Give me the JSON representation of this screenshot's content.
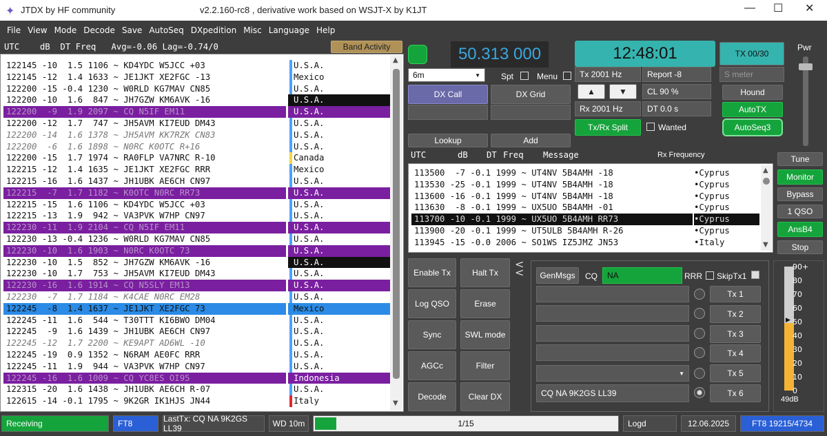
{
  "window": {
    "title": "JTDX   by HF community",
    "subtitle": "v2.2.160-rc8 , derivative work based on WSJT-X by K1JT"
  },
  "menu": [
    "File",
    "View",
    "Mode",
    "Decode",
    "Save",
    "AutoSeq",
    "DXpedition",
    "Misc",
    "Language",
    "Help"
  ],
  "band_activity": {
    "header": "UTC    dB  DT Freq   Avg=-0.06 Lag=-0.74/0",
    "button": "Band Activity",
    "rows": [
      {
        "t": "122145 -10  1.5 1106 ~ KD4YDC W5JCC +03",
        "c": "U.S.A.",
        "s": "norm",
        "m": "#4aa3ff"
      },
      {
        "t": "122145 -12  1.4 1633 ~ JE1JKT XE2FGC -13",
        "c": "Mexico",
        "s": "norm",
        "m": "#4aa3ff"
      },
      {
        "t": "122200 -15 -0.4 1230 ~ W0RLD KG7MAV CN85",
        "c": "U.S.A.",
        "s": "norm",
        "m": "#4aa3ff"
      },
      {
        "t": "122200 -10  1.6  847 ~ JH7GZW KM6AVK -16",
        "c": "U.S.A.",
        "s": "norm",
        "m": "#111"
      },
      {
        "t": "122200  -9  1.9 2097 ~ CQ N5IF EM11",
        "c": "U.S.A.",
        "s": "hl",
        "m": "#7a1fa0"
      },
      {
        "t": "122200 -12  1.7  747 ~ JH5AVM KI7EUD DM43",
        "c": "U.S.A.",
        "s": "norm",
        "m": "#4aa3ff"
      },
      {
        "t": "122200 -14  1.6 1378 ~ JH5AVM KK7RZK CN83",
        "c": "U.S.A.",
        "s": "old",
        "m": "#4aa3ff"
      },
      {
        "t": "122200  -6  1.6 1898 ~ N0RC K0OTC R+16",
        "c": "U.S.A.",
        "s": "old",
        "m": "#4aa3ff"
      },
      {
        "t": "122200 -15  1.7 1974 ~ RA0FLP VA7NRC R-10",
        "c": "Canada",
        "s": "norm",
        "m": "#f5d742"
      },
      {
        "t": "122215 -12  1.4 1635 ~ JE1JKT XE2FGC RRR",
        "c": "Mexico",
        "s": "norm",
        "m": "#4aa3ff"
      },
      {
        "t": "122215 -16  1.6 1437 ~ JH1UBK AE6CH CN97",
        "c": "U.S.A.",
        "s": "norm",
        "m": "#4aa3ff"
      },
      {
        "t": "122215  -7  1.7 1182 ~ K0OTC N0RC RR73",
        "c": "U.S.A.",
        "s": "hl",
        "m": "#7a1fa0"
      },
      {
        "t": "122215 -15  1.6 1106 ~ KD4YDC W5JCC +03",
        "c": "U.S.A.",
        "s": "norm",
        "m": "#4aa3ff"
      },
      {
        "t": "122215 -13  1.9  942 ~ VA3PVK W7HP CN97",
        "c": "U.S.A.",
        "s": "norm",
        "m": "#4aa3ff"
      },
      {
        "t": "122230 -11  1.9 2104 ~ CQ N5IF EM11",
        "c": "U.S.A.",
        "s": "hl",
        "m": "#7a1fa0"
      },
      {
        "t": "122230 -13 -0.4 1236 ~ W0RLD KG7MAV CN85",
        "c": "U.S.A.",
        "s": "norm",
        "m": "#4aa3ff"
      },
      {
        "t": "122230 -10  1.6 1903 ~ N0RC K0OTC 73",
        "c": "U.S.A.",
        "s": "hl",
        "m": "#7a1fa0"
      },
      {
        "t": "122230 -10  1.5  852 ~ JH7GZW KM6AVK -16",
        "c": "U.S.A.",
        "s": "norm",
        "m": "#111"
      },
      {
        "t": "122230 -10  1.7  753 ~ JH5AVM KI7EUD DM43",
        "c": "U.S.A.",
        "s": "norm",
        "m": "#4aa3ff"
      },
      {
        "t": "122230 -16  1.6 1914 ~ CQ N5SLY EM13",
        "c": "U.S.A.",
        "s": "hl",
        "m": "#7a1fa0"
      },
      {
        "t": "122230  -7  1.7 1184 ~ K4CAE N0RC EM28",
        "c": "U.S.A.",
        "s": "old",
        "m": "#4aa3ff"
      },
      {
        "t": "122245  -8  1.4 1637 ~ JE1JKT XE2FGC 73",
        "c": "Mexico",
        "s": "sel",
        "m": "#2b8be6"
      },
      {
        "t": "122245 -11  1.6  544 ~ T30TTT KI6BWO DM04",
        "c": "U.S.A.",
        "s": "norm",
        "m": "#4aa3ff"
      },
      {
        "t": "122245  -9  1.6 1439 ~ JH1UBK AE6CH CN97",
        "c": "U.S.A.",
        "s": "norm",
        "m": "#4aa3ff"
      },
      {
        "t": "122245 -12  1.7 2200 ~ KE9APT AD6WL -10",
        "c": "U.S.A.",
        "s": "old",
        "m": "#4aa3ff"
      },
      {
        "t": "122245 -19  0.9 1352 ~ N6RAM AE0FC RRR",
        "c": "U.S.A.",
        "s": "norm",
        "m": "#4aa3ff"
      },
      {
        "t": "122245 -11  1.9  944 ~ VA3PVK W7HP CN97",
        "c": "U.S.A.",
        "s": "norm",
        "m": "#4aa3ff"
      },
      {
        "t": "122245 -16  1.6 1009 ~ CQ YC8ES OI95",
        "c": "Indonesia",
        "s": "hl",
        "m": "#7a1fa0"
      },
      {
        "t": "122315 -20  1.6 1438 ~ JH1UBK AE6CH R-07",
        "c": "U.S.A.",
        "s": "norm",
        "m": "#4aa3ff"
      },
      {
        "t": "122615 -14 -0.1 1795 ~ 9K2GR IK1HJS JN44",
        "c": "Italy",
        "s": "norm",
        "m": "#e3262d"
      }
    ]
  },
  "frequency": "50.313 000",
  "clock": "12:48:01",
  "tx_counter": "TX 00/30",
  "band": "6m",
  "spt": "Spt",
  "menu_label": "Menu",
  "tx_hz": "Tx  2001 Hz",
  "rx_hz": "Rx  2001 Hz",
  "report": "Report -8",
  "smeter": "S meter",
  "cl": "CL  90 %",
  "dt": "DT 0.0 s",
  "wanted": "Wanted",
  "buttons": {
    "dx_call": "DX Call",
    "dx_grid": "DX Grid",
    "lookup": "Lookup",
    "add": "Add",
    "hound": "Hound",
    "autotx": "AutoTX",
    "txrx_split": "Tx/Rx Split",
    "autoseq3": "AutoSeq3",
    "tune": "Tune",
    "monitor": "Monitor",
    "bypass": "Bypass",
    "one_qso": "1 QSO",
    "ansb4": "AnsB4",
    "stop": "Stop",
    "up": "▲",
    "down": "▼",
    "enable_tx": "Enable Tx",
    "halt_tx": "Halt Tx",
    "log_qso": "Log QSO",
    "erase": "Erase",
    "sync": "Sync",
    "swl_mode": "SWL mode",
    "agcc": "AGCc",
    "filter": "Filter",
    "decode": "Decode",
    "clear_dx": "Clear DX",
    "genmsgs": "GenMsgs",
    "tx1": "Tx 1",
    "tx2": "Tx 2",
    "tx3": "Tx 3",
    "tx4": "Tx 4",
    "tx5": "Tx 5",
    "tx6": "Tx 6"
  },
  "pwr": "Pwr",
  "rx_freq": {
    "header_utc": "UTC",
    "header_db": "dB",
    "header_dt": "DT",
    "header_freq": "Freq",
    "header_msg": "Message",
    "header_title": "Rx Frequency",
    "rows": [
      {
        "t": "113500  -7 -0.1 1999 ~ UT4NV 5B4AMH -18",
        "c": "Cyprus",
        "sel": false
      },
      {
        "t": "113530 -25 -0.1 1999 ~ UT4NV 5B4AMH -18",
        "c": "Cyprus",
        "sel": false
      },
      {
        "t": "113600 -16 -0.1 1999 ~ UT4NV 5B4AMH -18",
        "c": "Cyprus",
        "sel": false
      },
      {
        "t": "113630  -8 -0.1 1999 ~ UX5UO 5B4AMH -01",
        "c": "Cyprus",
        "sel": false
      },
      {
        "t": "113700 -10 -0.1 1999 ~ UX5UO 5B4AMH RR73",
        "c": "Cyprus",
        "sel": true
      },
      {
        "t": "113900 -20 -0.1 1999 ~ UT5ULB 5B4AMH R-26",
        "c": "Cyprus",
        "sel": false
      },
      {
        "t": "113945 -15 -0.0 2006 ~ SO1WS IZ5JMZ JN53",
        "c": "Italy",
        "sel": false
      }
    ]
  },
  "cq": "CQ",
  "cq_value": "NA",
  "rrr": "RRR",
  "skiptx1": "SkipTx1",
  "tx6_msg": "CQ NA 9K2GS LL39",
  "meter": {
    "ticks": [
      "90+",
      "80",
      "70",
      "60",
      "50",
      "40",
      "30",
      "20",
      "10",
      "0"
    ],
    "level": "49dB",
    "value": 49
  },
  "status": {
    "receiving": "Receiving",
    "mode": "FT8",
    "lasttx": "LastTx: CQ NA 9K2GS LL39",
    "wd": "WD 10m",
    "progress": "1/15",
    "progress_value": 0.07,
    "logd": "Logd",
    "date": "12.06.2025",
    "ft8": "FT8  19215/4734"
  },
  "colors": {
    "green": "#15a43b",
    "teal": "#35b3ae",
    "purple": "#7a1fa0",
    "blue": "#2b8be6",
    "yellow": "#f5b335"
  }
}
